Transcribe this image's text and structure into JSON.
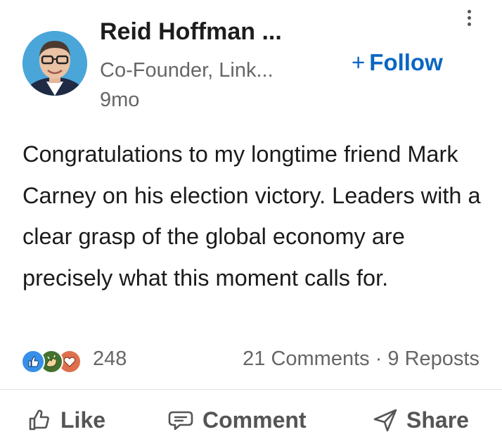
{
  "author": {
    "name": "Reid Hoffman ...",
    "headline": "Co-Founder, Link...",
    "time": "9mo"
  },
  "follow_label": "Follow",
  "follow_prefix": "+",
  "post_text": "Congratulations to my longtime friend Mark Carney on his election victory. Leaders with a clear grasp of the global economy are precisely what this moment calls for.",
  "reactions": {
    "icons": [
      "like-icon",
      "celebrate-icon",
      "love-icon"
    ],
    "count": "248"
  },
  "engagement": {
    "comments": "21 Comments",
    "separator": " · ",
    "reposts": "9 Reposts"
  },
  "actions": {
    "like": "Like",
    "comment": "Comment",
    "share": "Share"
  },
  "colors": {
    "accent": "#0a66c2",
    "muted": "#666666",
    "like": "#378fe9",
    "celebrate": "#44712e",
    "love": "#df704d"
  },
  "icons": {
    "more": "more-vertical-icon",
    "like_action": "thumbs-up-outline-icon",
    "comment_action": "speech-bubble-icon",
    "share_action": "send-arrow-icon"
  }
}
